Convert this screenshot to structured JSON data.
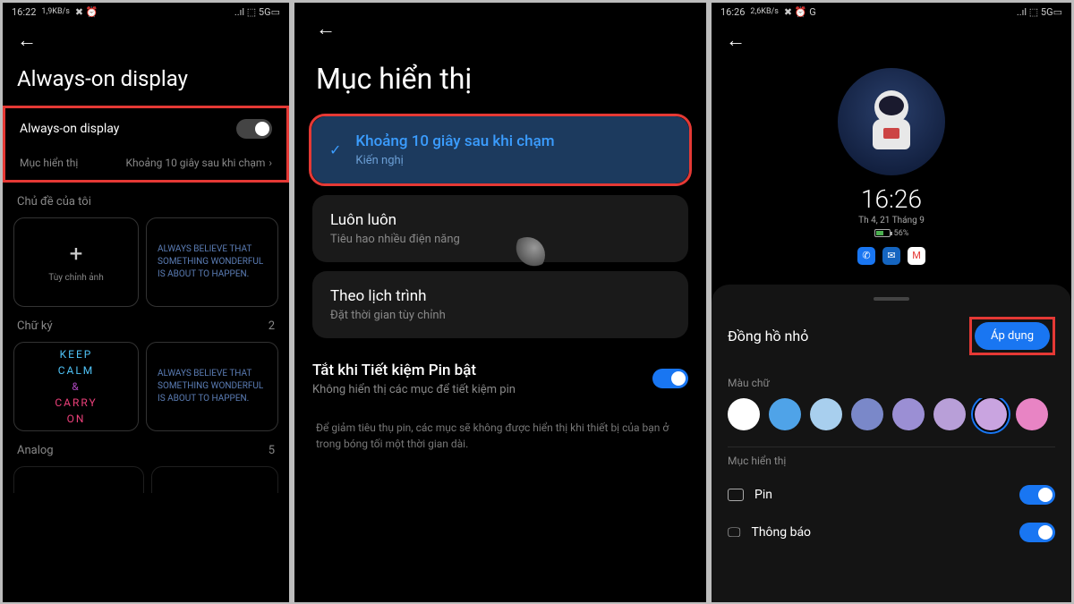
{
  "phone1": {
    "status": {
      "time": "16:22",
      "speed": "1,9KB/s",
      "icons": "✖ ⏰",
      "signal": "..ıl ⬚ 5G▭"
    },
    "title": "Always-on display",
    "toggle_label": "Always-on display",
    "subrow_label": "Mục hiển thị",
    "subrow_value": "Khoảng 10 giây sau khi chạm",
    "section_themes": "Chủ đề của tôi",
    "tile_custom": "Tùy chỉnh ảnh",
    "tile_believe": "ALWAYS BELIEVE THAT SOMETHING WONDERFUL IS ABOUT TO HAPPEN.",
    "section_sig": "Chữ ký",
    "section_sig_count": "2",
    "keepcalm": [
      "KEEP",
      "CALM",
      "&",
      "CARRY",
      "ON"
    ],
    "section_analog": "Analog",
    "section_analog_count": "5"
  },
  "phone2": {
    "title": "Mục hiển thị",
    "opt1_title": "Khoảng 10 giây sau khi chạm",
    "opt1_sub": "Kiến nghị",
    "opt2_title": "Luôn luôn",
    "opt2_sub": "Tiêu hao nhiều điện năng",
    "opt3_title": "Theo lịch trình",
    "opt3_sub": "Đặt thời gian tùy chỉnh",
    "save_title": "Tắt khi Tiết kiệm Pin bật",
    "save_sub": "Không hiển thị các mục để tiết kiệm pin",
    "help": "Để giảm tiêu thụ pin, các mục sẽ không được hiển thị khi thiết bị của bạn ở trong bóng tối một thời gian dài."
  },
  "phone3": {
    "status": {
      "time": "16:26",
      "speed": "2,6KB/s",
      "icons": "✖ ⏰ G",
      "signal": "..ıl ⬚ 5G▭"
    },
    "preview_time": "16:26",
    "preview_date": "Th 4, 21 Tháng 9",
    "preview_battery": "56%",
    "sheet_title": "Đồng hồ nhỏ",
    "apply": "Áp dụng",
    "color_label": "Màu chữ",
    "colors": [
      "#ffffff",
      "#4fa3e8",
      "#a8cfee",
      "#7a88c9",
      "#9b8fd4",
      "#b89fd8",
      "#c9a4e0",
      "#e884c4"
    ],
    "selected_color": 6,
    "items_label": "Mục hiển thị",
    "row_pin": "Pin",
    "row_notif": "Thông báo"
  }
}
